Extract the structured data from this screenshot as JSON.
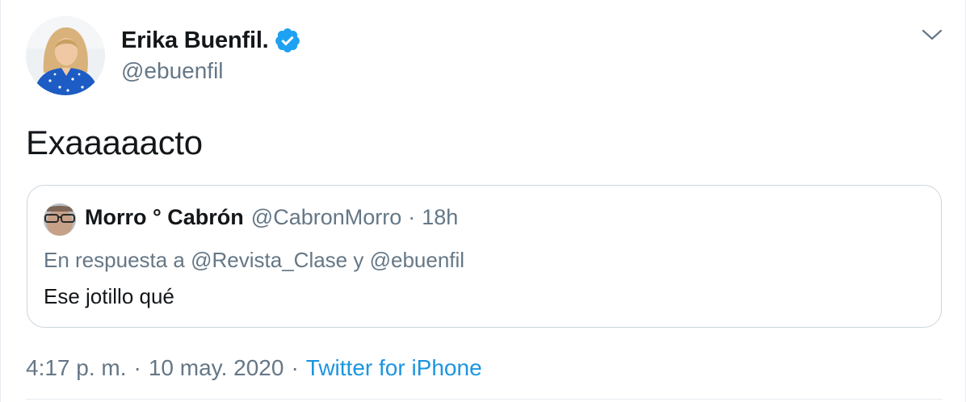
{
  "author": {
    "name": "Erika Buenfil.",
    "handle": "@ebuenfil",
    "verified": true,
    "verified_color": "#1da1f2"
  },
  "tweet": {
    "text": "Exaaaaacto"
  },
  "quoted_tweet": {
    "name": "Morro ° Cabrón",
    "handle": "@CabronMorro",
    "separator": "·",
    "time": "18h",
    "reply_line": "En respuesta a @Revista_Clase y @ebuenfil",
    "text": "Ese jotillo qué"
  },
  "meta": {
    "time": "4:17 p. m.",
    "separator": "·",
    "date": "10 may. 2020",
    "source": "Twitter for iPhone",
    "source_color": "#1b95e0"
  },
  "icons": {
    "menu": "chevron-down-icon",
    "verified": "verified-badge-icon"
  },
  "colors": {
    "text": "#14171a",
    "secondary": "#657786",
    "border": "#ccd6dd"
  }
}
